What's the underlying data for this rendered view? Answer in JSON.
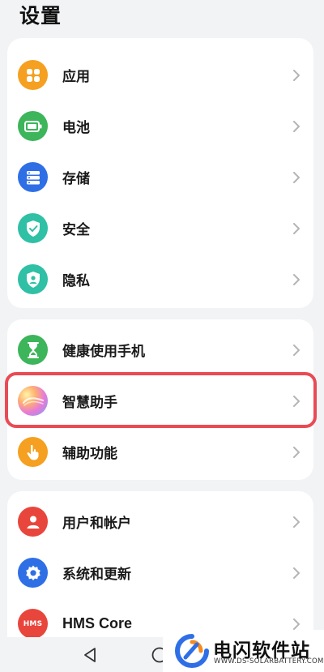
{
  "header": {
    "title": "设置"
  },
  "group1": {
    "items": [
      {
        "label": "应用",
        "icon": "apps-icon",
        "color": "#f5a020"
      },
      {
        "label": "电池",
        "icon": "battery-icon",
        "color": "#3db55a"
      },
      {
        "label": "存储",
        "icon": "storage-icon",
        "color": "#2f6fe6"
      },
      {
        "label": "安全",
        "icon": "shield-icon",
        "color": "#2fc0a5"
      },
      {
        "label": "隐私",
        "icon": "privacy-icon",
        "color": "#2fc0a5"
      }
    ]
  },
  "group2": {
    "items": [
      {
        "label": "健康使用手机",
        "icon": "hourglass-icon",
        "color": "#3db55a"
      },
      {
        "label": "智慧助手",
        "icon": "assistant-icon",
        "color": "#c87cf0",
        "highlighted": true
      },
      {
        "label": "辅助功能",
        "icon": "hand-icon",
        "color": "#f5a020"
      }
    ]
  },
  "group3": {
    "items": [
      {
        "label": "用户和帐户",
        "icon": "user-icon",
        "color": "#e8463c"
      },
      {
        "label": "系统和更新",
        "icon": "system-gear-icon",
        "color": "#2f6fe6"
      },
      {
        "label": "HMS Core",
        "icon": "hms-icon",
        "color": "#e8463c",
        "icon_text": "HMS"
      }
    ]
  },
  "watermark": {
    "name": "电闪软件站",
    "url": "WWW.DS-SOLARBATTERY.COM"
  }
}
